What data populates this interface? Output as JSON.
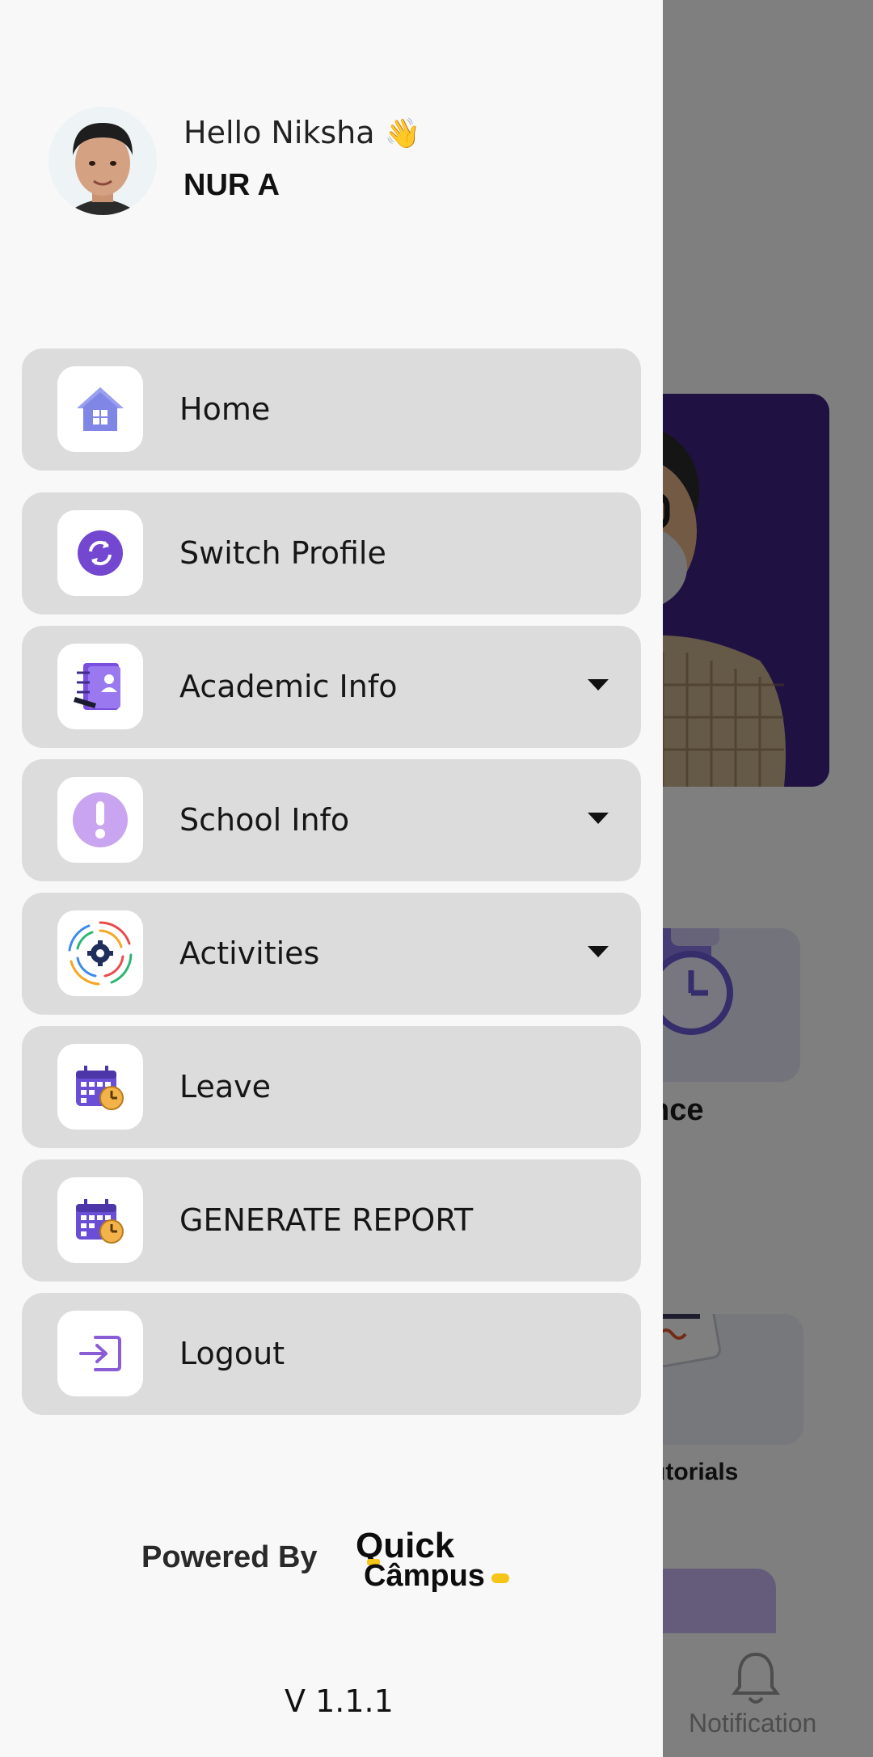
{
  "user": {
    "greeting": "Hello Niksha",
    "wave_emoji": "👋",
    "class": "NUR A"
  },
  "menu": [
    {
      "label": "Home",
      "icon": "home-icon",
      "has_dropdown": false
    },
    {
      "label": "Switch Profile",
      "icon": "switch-profile-icon",
      "has_dropdown": false
    },
    {
      "label": "Academic Info",
      "icon": "academic-info-icon",
      "has_dropdown": true
    },
    {
      "label": "School Info",
      "icon": "school-info-icon",
      "has_dropdown": true
    },
    {
      "label": "Activities",
      "icon": "activities-icon",
      "has_dropdown": true
    },
    {
      "label": "Leave",
      "icon": "leave-calendar-icon",
      "has_dropdown": false
    },
    {
      "label": "GENERATE REPORT",
      "icon": "report-calendar-icon",
      "has_dropdown": false
    },
    {
      "label": "Logout",
      "icon": "logout-icon",
      "has_dropdown": false
    }
  ],
  "footer": {
    "powered_by": "Powered By",
    "brand_line1": "Quick",
    "brand_line2": "Câmpus",
    "version": "V 1.1.1"
  },
  "background": {
    "tile_label_1": "nce",
    "tile_label_2": "utorials",
    "nav_notification": "Notification"
  },
  "colors": {
    "accent": "#7b5cd6",
    "menu_bg": "#dcdcdc",
    "drawer_bg": "#f8f8f8",
    "brand_yellow": "#f5c518"
  }
}
